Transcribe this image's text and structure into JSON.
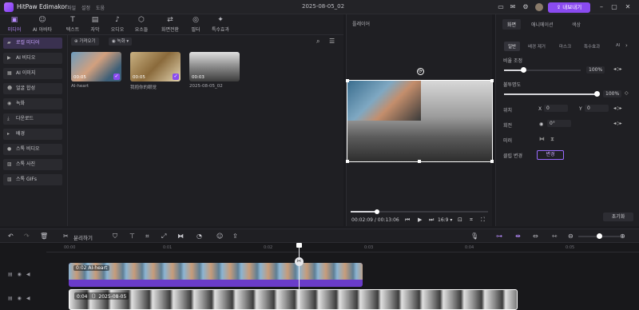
{
  "titlebar": {
    "app_title": "HitPaw Edimakor",
    "menus": [
      "파일",
      "설정",
      "도움"
    ],
    "project_name": "2025-08-05_02",
    "export_label": "⇪ 내보내기"
  },
  "toolbar": {
    "tabs": [
      {
        "label": "미디어",
        "icon": "media-icon"
      },
      {
        "label": "AI 아바타",
        "icon": "avatar-icon"
      },
      {
        "label": "텍스트",
        "icon": "text-icon"
      },
      {
        "label": "자막",
        "icon": "subtitle-icon"
      },
      {
        "label": "오디오",
        "icon": "audio-icon"
      },
      {
        "label": "요소들",
        "icon": "elements-icon"
      },
      {
        "label": "화면전환",
        "icon": "transition-icon"
      },
      {
        "label": "필터",
        "icon": "filter-icon"
      },
      {
        "label": "특수효과",
        "icon": "effects-icon"
      }
    ]
  },
  "sidebar": {
    "items": [
      {
        "label": "로컬 미디어",
        "icon": "folder-icon"
      },
      {
        "label": "AI 비디오",
        "icon": "ai-video-icon"
      },
      {
        "label": "AI 이미지",
        "icon": "ai-image-icon"
      },
      {
        "label": "얼굴 합성",
        "icon": "face-swap-icon"
      },
      {
        "label": "녹화",
        "icon": "record-icon"
      },
      {
        "label": "다운로드",
        "icon": "download-icon"
      },
      {
        "label": "배경",
        "icon": "background-icon"
      },
      {
        "label": "스톡 비디오",
        "icon": "stock-video-icon"
      },
      {
        "label": "스톡 사진",
        "icon": "stock-photo-icon"
      },
      {
        "label": "스톡 GIFs",
        "icon": "gif-icon"
      }
    ]
  },
  "media": {
    "import_label": "⊕ 가져오기",
    "record_label": "◉ 녹화 ▾",
    "items": [
      {
        "name": "AI-heart",
        "duration": "00:05",
        "selected": true
      },
      {
        "name": "我抱你的眼觉",
        "duration": "00:05",
        "selected": true
      },
      {
        "name": "2025-08-05_02",
        "duration": "00:03",
        "selected": false
      }
    ]
  },
  "player": {
    "title": "플레이어",
    "time": "00:02:09 / 00:13:06",
    "aspect": "16:9 ▾",
    "progress": 0.16
  },
  "properties": {
    "tabs": [
      "화면",
      "애니메이션",
      "색상"
    ],
    "sub_tabs": [
      "일반",
      "배경 제거",
      "마스크",
      "특수효과",
      "AI"
    ],
    "scale_label": "비율 조정",
    "scale_value": "100%",
    "opacity_label": "불투명도",
    "opacity_value": "100%",
    "position_label": "위치",
    "pos_x_label": "X",
    "pos_x": "0",
    "pos_y_label": "Y",
    "pos_y": "0",
    "rotate_label": "회전",
    "rotate_value": "0°",
    "mirror_label": "미러",
    "clip_change_label": "클립 변경",
    "change_button": "변경",
    "reset_button": "초기화"
  },
  "timeline_toolbar": {
    "split_label": "분리하기"
  },
  "timeline": {
    "ruler": [
      "00:00",
      "0:01",
      "0:02",
      "0:03",
      "0:04",
      "0:05"
    ],
    "clips": [
      {
        "label": "0:02 AI-heart"
      },
      {
        "label": "0:04 〔〕2025-08-05"
      }
    ]
  }
}
